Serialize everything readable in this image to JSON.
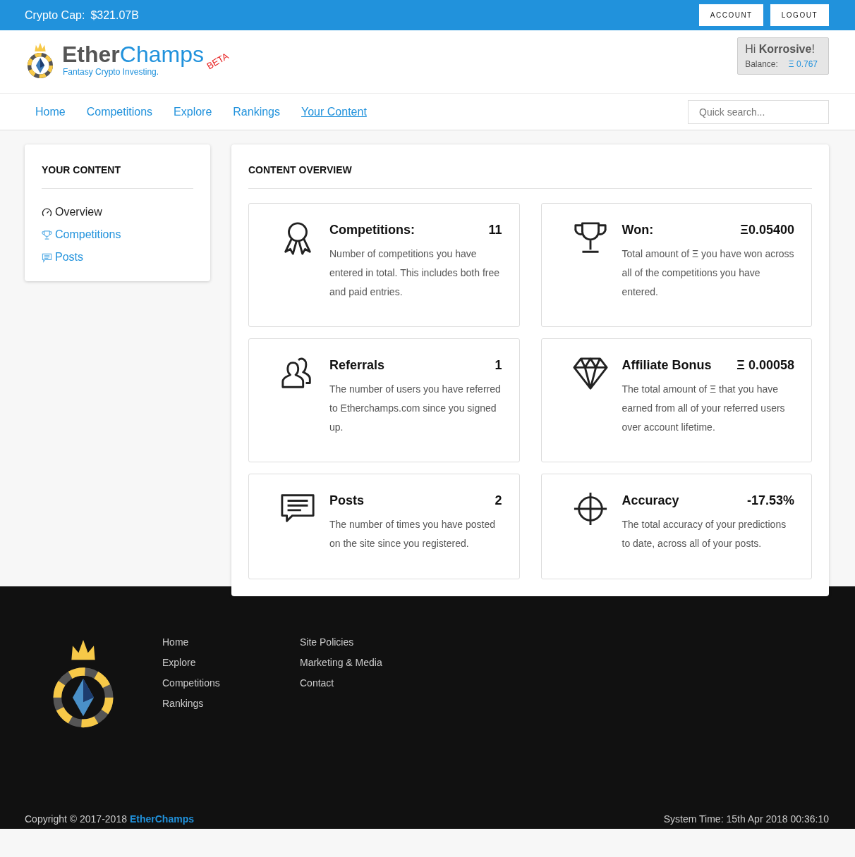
{
  "top_bar": {
    "cap_label": "Crypto Cap:",
    "cap_value": "$321.07B",
    "buttons": [
      "ACCOUNT",
      "LOGOUT"
    ]
  },
  "header": {
    "brand_dark": "Ether",
    "brand_blue": "Champs",
    "badge": "BETA",
    "tagline": "Fantasy Crypto Investing.",
    "greeting": "Hi **Korrosive**!",
    "balance_label": "Balance:",
    "balance_value": "Ξ 0.767"
  },
  "nav": {
    "items": [
      {
        "label": "Home",
        "selected": false
      },
      {
        "label": "Competitions",
        "selected": false
      },
      {
        "label": "Explore",
        "selected": false
      },
      {
        "label": "Rankings",
        "selected": false
      },
      {
        "label": "Your Content",
        "selected": true
      }
    ],
    "search": {
      "placeholder": "Quick search..."
    }
  },
  "sidebar": {
    "title": "YOUR CONTENT",
    "items": [
      {
        "label": "Overview",
        "kind": "gauge",
        "selected": true
      },
      {
        "label": "Competitions",
        "kind": "trophy",
        "selected": false
      },
      {
        "label": "Posts",
        "kind": "comment",
        "selected": false
      }
    ]
  },
  "overview": {
    "title": "CONTENT OVERVIEW",
    "cards": [
      {
        "kind": "award",
        "title": "Competitions:",
        "value": "11",
        "description": "Number of competitions you have entered in total. This includes both free and paid entries."
      },
      {
        "kind": "trophy",
        "title": "Won:",
        "value": "Ξ0.05400",
        "description": "Total amount of Ξ you have won across all of the competitions you have entered."
      },
      {
        "kind": "users",
        "title": "Referrals",
        "value": "1",
        "description": "The number of users you have referred to Etherchamps.com since you signed up."
      },
      {
        "kind": "diamond",
        "title": "Affiliate Bonus",
        "value": "Ξ 0.00058",
        "description": "The total amount of Ξ that you have earned from all of your referred users over account lifetime."
      },
      {
        "kind": "comment",
        "title": "Posts",
        "value": "2",
        "description": "The number of times you have posted on the site since you registered."
      },
      {
        "kind": "crosshair",
        "title": "Accuracy",
        "value": "-17.53%",
        "description": "The total accuracy of your predictions to date, across all of your posts."
      }
    ]
  },
  "footer": {
    "links_1": [
      "Home",
      "Explore",
      "Competitions",
      "Rankings"
    ],
    "links_2": [
      "Site Policies",
      "Marketing & Media",
      "Contact"
    ],
    "copyright": "Copyright © 2017-2018",
    "copyright_brand": "EtherChamps",
    "system_time": "System Time: 15th Apr 2018 00:36:10"
  }
}
